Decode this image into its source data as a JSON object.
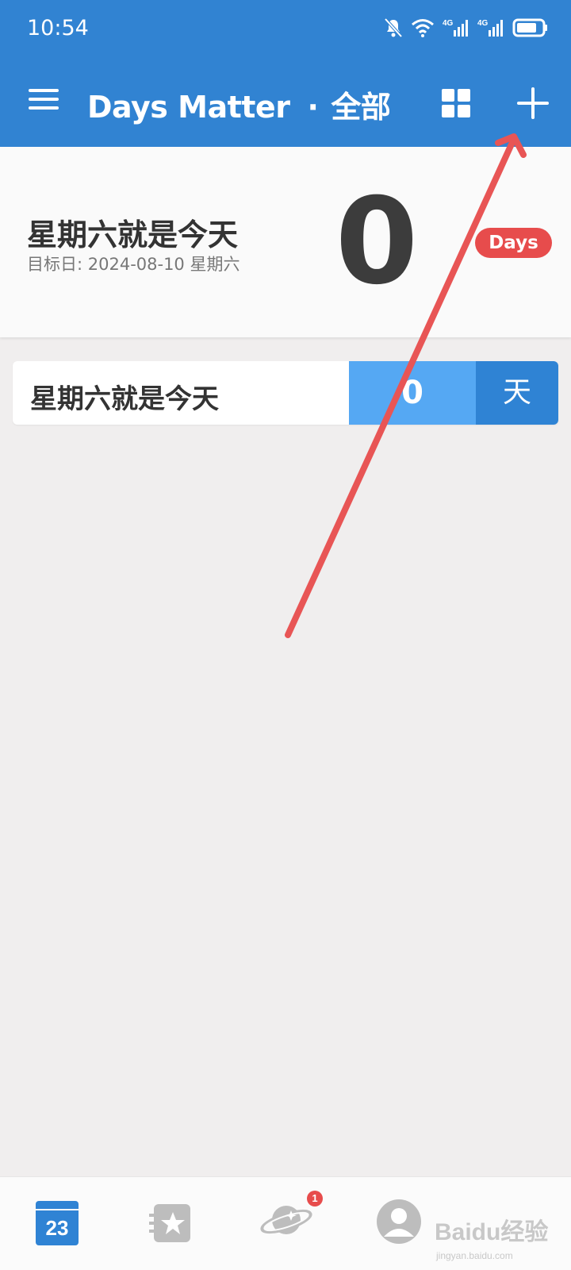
{
  "status_bar": {
    "time": "10:54",
    "icons": [
      "bell-muted-icon",
      "wifi-icon",
      "signal-4g-icon",
      "signal-4g-icon",
      "battery-icon"
    ]
  },
  "header": {
    "title": "Days Matter",
    "separator": "·",
    "category": "全部",
    "menu_icon": "hamburger-menu-icon",
    "grid_icon": "grid-view-icon",
    "add_icon": "plus-icon",
    "background": "#3183d2"
  },
  "hero": {
    "title": "星期六就是今天",
    "target_date": "目标日: 2024-08-10 星期六",
    "count": "0",
    "badge": "Days",
    "badge_color": "#e74c4c"
  },
  "list": {
    "items": [
      {
        "title": "星期六就是今天",
        "count": "0",
        "unit": "天"
      }
    ],
    "count_color": "#55a8f3",
    "unit_color": "#2f83d4"
  },
  "bottom_nav": {
    "items": [
      {
        "icon": "calendar-icon",
        "text": "23"
      },
      {
        "icon": "star-card-icon"
      },
      {
        "icon": "planet-icon",
        "badge": "1"
      },
      {
        "icon": "profile-icon"
      }
    ]
  },
  "annotation": {
    "icon": "red-arrow-icon",
    "color": "#e85555"
  },
  "watermark": {
    "brand": "Baidu经验",
    "url": "jingyan.baidu.com"
  }
}
